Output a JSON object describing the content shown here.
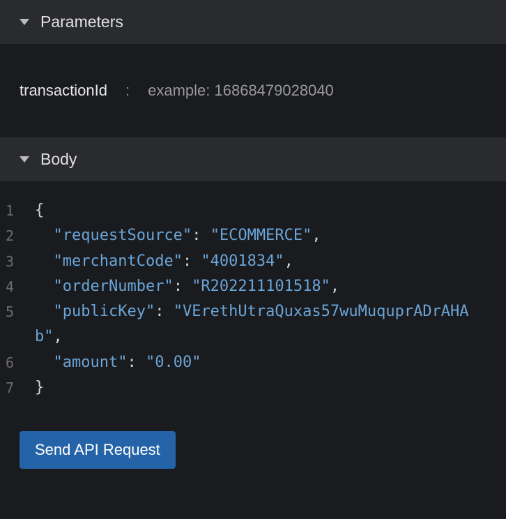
{
  "sections": {
    "parameters": {
      "title": "Parameters"
    },
    "body": {
      "title": "Body"
    }
  },
  "parameter": {
    "name": "transactionId",
    "separator": ":",
    "example_label": "example:",
    "example_value": "16868479028040"
  },
  "body_json": {
    "requestSource": "ECOMMERCE",
    "merchantCode": "4001834",
    "orderNumber": "R202211101518",
    "publicKey": "VErethUtraQuxas57wuMuquprADrAHAb",
    "amount": "0.00"
  },
  "code_lines": [
    {
      "n": "1",
      "tokens": [
        {
          "t": "brace",
          "v": "{"
        }
      ]
    },
    {
      "n": "2",
      "tokens": [
        {
          "t": "indent",
          "v": "  "
        },
        {
          "t": "key",
          "v": "\"requestSource\""
        },
        {
          "t": "colon",
          "v": ": "
        },
        {
          "t": "string",
          "v": "\"ECOMMERCE\""
        },
        {
          "t": "comma",
          "v": ","
        }
      ]
    },
    {
      "n": "3",
      "tokens": [
        {
          "t": "indent",
          "v": "  "
        },
        {
          "t": "key",
          "v": "\"merchantCode\""
        },
        {
          "t": "colon",
          "v": ": "
        },
        {
          "t": "string",
          "v": "\"4001834\""
        },
        {
          "t": "comma",
          "v": ","
        }
      ]
    },
    {
      "n": "4",
      "tokens": [
        {
          "t": "indent",
          "v": "  "
        },
        {
          "t": "key",
          "v": "\"orderNumber\""
        },
        {
          "t": "colon",
          "v": ": "
        },
        {
          "t": "string",
          "v": "\"R202211101518\""
        },
        {
          "t": "comma",
          "v": ","
        }
      ]
    },
    {
      "n": "5",
      "tokens": [
        {
          "t": "indent",
          "v": "  "
        },
        {
          "t": "key",
          "v": "\"publicKey\""
        },
        {
          "t": "colon",
          "v": ": "
        },
        {
          "t": "string",
          "v": "\"VErethUtraQuxas57wuMuquprADrAHAb\""
        },
        {
          "t": "comma",
          "v": ","
        }
      ]
    },
    {
      "n": "6",
      "tokens": [
        {
          "t": "indent",
          "v": "  "
        },
        {
          "t": "key",
          "v": "\"amount\""
        },
        {
          "t": "colon",
          "v": ": "
        },
        {
          "t": "string",
          "v": "\"0.00\""
        }
      ]
    },
    {
      "n": "7",
      "tokens": [
        {
          "t": "brace",
          "v": "}"
        }
      ]
    }
  ],
  "actions": {
    "send_label": "Send API Request"
  }
}
